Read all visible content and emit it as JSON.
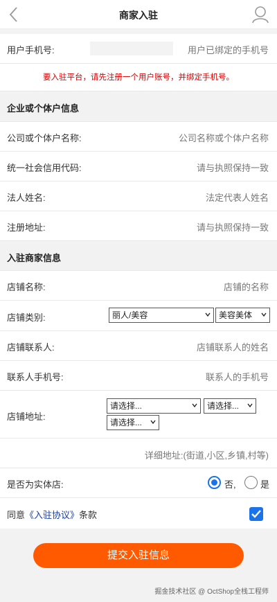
{
  "header": {
    "title": "商家入驻",
    "back_icon": "chevron-left-icon",
    "user_icon": "user-icon"
  },
  "phone": {
    "label": "用户手机号:",
    "placeholder": "用户已绑定的手机号"
  },
  "notice": "要入驻平台，请先注册一个用户账号，并绑定手机号。",
  "company_section": {
    "title": "企业或个体户信息",
    "fields": [
      {
        "label": "公司或个体户名称:",
        "placeholder": "公司名称或个体户名称"
      },
      {
        "label": "统一社会信用代码:",
        "placeholder": "请与执照保持一致"
      },
      {
        "label": "法人姓名:",
        "placeholder": "法定代表人姓名"
      },
      {
        "label": "注册地址:",
        "placeholder": "请与执照保持一致"
      }
    ]
  },
  "shop_section": {
    "title": "入驻商家信息",
    "shop_name": {
      "label": "店铺名称:",
      "placeholder": "店铺的名称"
    },
    "category": {
      "label": "店铺类别:",
      "select1": "丽人/美容",
      "select2": "美容美体"
    },
    "contact": {
      "label": "店铺联系人:",
      "placeholder": "店铺联系人的姓名"
    },
    "contact_phone": {
      "label": "联系人手机号:",
      "placeholder": "联系人的手机号"
    },
    "address": {
      "label": "店铺地址:",
      "select1": "请选择...",
      "select2": "请选择...",
      "select3": "请选择...",
      "detail_placeholder": "详细地址:(街道,小区,乡镇,村等)"
    },
    "physical": {
      "label": "是否为实体店:",
      "option_no": "否,",
      "option_yes": "是",
      "selected": "否"
    },
    "agree": {
      "prefix": "同意",
      "link": "《入驻协议》",
      "suffix": "条款",
      "checked": true
    }
  },
  "submit_label": "提交入驻信息",
  "footer": "掘金技术社区 @ OctShop全栈工程师",
  "colors": {
    "accent": "#ff5a00",
    "notice": "#dd0000",
    "check": "#1a73e8"
  }
}
